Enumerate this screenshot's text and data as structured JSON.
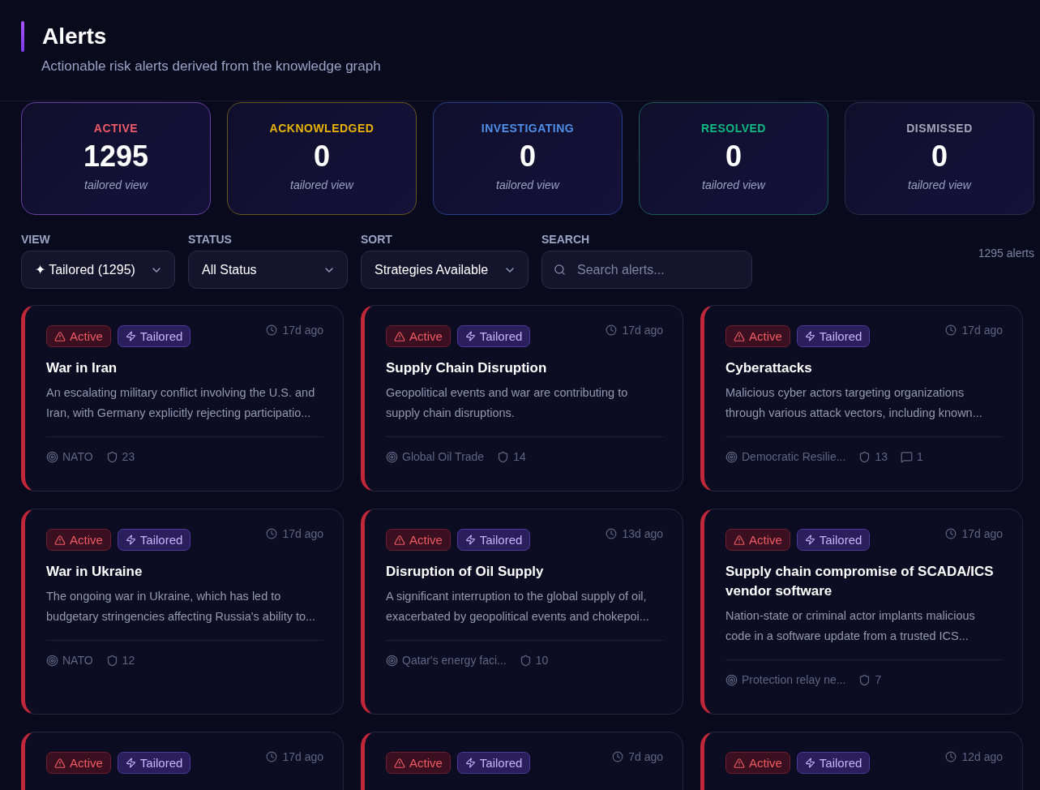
{
  "header": {
    "title": "Alerts",
    "subtitle": "Actionable risk alerts derived from the knowledge graph"
  },
  "stats": [
    {
      "kind": "active",
      "label": "ACTIVE",
      "value": "1295",
      "note": "tailored view"
    },
    {
      "kind": "acknowledged",
      "label": "ACKNOWLEDGED",
      "value": "0",
      "note": "tailored view"
    },
    {
      "kind": "investigating",
      "label": "INVESTIGATING",
      "value": "0",
      "note": "tailored view"
    },
    {
      "kind": "resolved",
      "label": "RESOLVED",
      "value": "0",
      "note": "tailored view"
    },
    {
      "kind": "dismissed",
      "label": "DISMISSED",
      "value": "0",
      "note": "tailored view"
    }
  ],
  "filters": {
    "view": {
      "label": "VIEW",
      "value": "✦ Tailored (1295)"
    },
    "status": {
      "label": "STATUS",
      "value": "All Status"
    },
    "sort": {
      "label": "SORT",
      "value": "Strategies Available"
    },
    "search": {
      "label": "SEARCH",
      "placeholder": "Search alerts..."
    },
    "count": "1295 alerts"
  },
  "alerts": [
    {
      "kind": "active",
      "status_label": "Active",
      "tag": "Tailored",
      "time": "17d ago",
      "title": "War in Iran",
      "description": "An escalating military conflict involving the U.S. and Iran, with Germany explicitly rejecting participatio...",
      "target": "NATO",
      "strategies": "23"
    },
    {
      "kind": "active",
      "status_label": "Active",
      "tag": "Tailored",
      "time": "17d ago",
      "title": "Supply Chain Disruption",
      "description": "Geopolitical events and war are contributing to supply chain disruptions.",
      "target": "Global Oil Trade",
      "strategies": "14"
    },
    {
      "kind": "active",
      "status_label": "Active",
      "tag": "Tailored",
      "time": "17d ago",
      "title": "Cyberattacks",
      "description": "Malicious cyber actors targeting organizations through various attack vectors, including known...",
      "target": "Democratic Resilie...",
      "strategies": "13",
      "comments": "1"
    },
    {
      "kind": "active",
      "status_label": "Active",
      "tag": "Tailored",
      "time": "17d ago",
      "title": "War in Ukraine",
      "description": "The ongoing war in Ukraine, which has led to budgetary stringencies affecting Russia's ability to...",
      "target": "NATO",
      "strategies": "12"
    },
    {
      "kind": "active",
      "status_label": "Active",
      "tag": "Tailored",
      "time": "13d ago",
      "title": "Disruption of Oil Supply",
      "description": "A significant interruption to the global supply of oil, exacerbated by geopolitical events and chokepoi...",
      "target": "Qatar's energy faci...",
      "strategies": "10"
    },
    {
      "kind": "active",
      "status_label": "Active",
      "tag": "Tailored",
      "time": "17d ago",
      "title": "Supply chain compromise of SCADA/ICS vendor software",
      "description": "Nation-state or criminal actor implants malicious code in a software update from a trusted ICS...",
      "target": "Protection relay ne...",
      "strategies": "7"
    },
    {
      "kind": "active",
      "status_label": "Active",
      "tag": "Tailored",
      "time": "17d ago"
    },
    {
      "kind": "active",
      "status_label": "Active",
      "tag": "Tailored",
      "time": "7d ago"
    },
    {
      "kind": "active",
      "status_label": "Active",
      "tag": "Tailored",
      "time": "12d ago"
    }
  ]
}
